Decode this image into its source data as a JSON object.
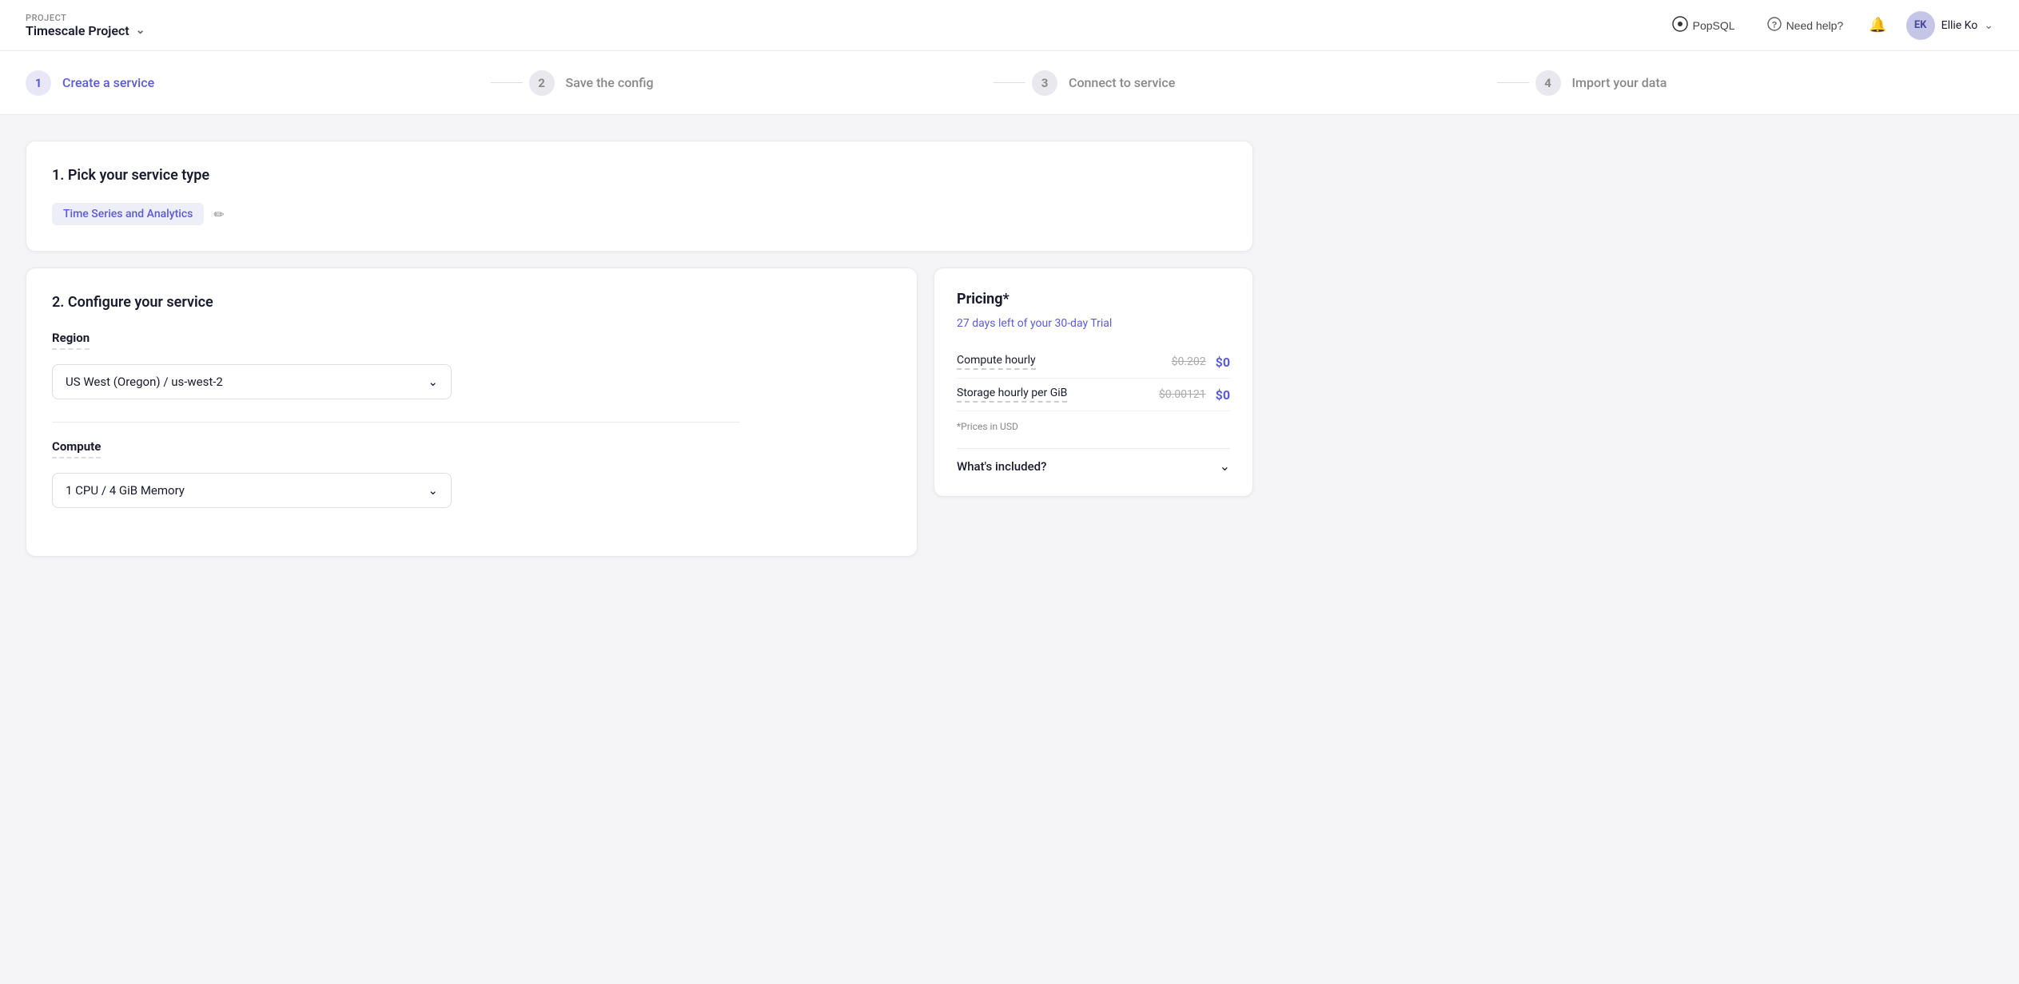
{
  "header": {
    "project_label": "PROJECT",
    "project_name": "Timescale Project",
    "popsql_label": "PopSQL",
    "need_help_label": "Need help?",
    "user_initials": "EK",
    "user_name": "Ellie Ko"
  },
  "stepper": {
    "steps": [
      {
        "number": "1",
        "label": "Create a service",
        "state": "active"
      },
      {
        "number": "2",
        "label": "Save the config",
        "state": "inactive"
      },
      {
        "number": "3",
        "label": "Connect to service",
        "state": "inactive"
      },
      {
        "number": "4",
        "label": "Import your data",
        "state": "inactive"
      }
    ]
  },
  "pick_service": {
    "title": "1. Pick your service type",
    "service_type": "Time Series and Analytics",
    "edit_icon": "✏"
  },
  "configure": {
    "title": "2. Configure your service",
    "region_label": "Region",
    "region_value": "US West (Oregon) / us-west-2",
    "compute_label": "Compute",
    "compute_value": "1 CPU / 4 GiB Memory"
  },
  "pricing": {
    "title": "Pricing*",
    "trial_text": "27 days left of your 30-day Trial",
    "compute_label": "Compute hourly",
    "compute_original": "$0.202",
    "compute_new": "$0",
    "storage_label": "Storage hourly per GiB",
    "storage_original": "$0.00121",
    "storage_new": "$0",
    "note": "*Prices in USD",
    "whats_included": "What's included?"
  }
}
